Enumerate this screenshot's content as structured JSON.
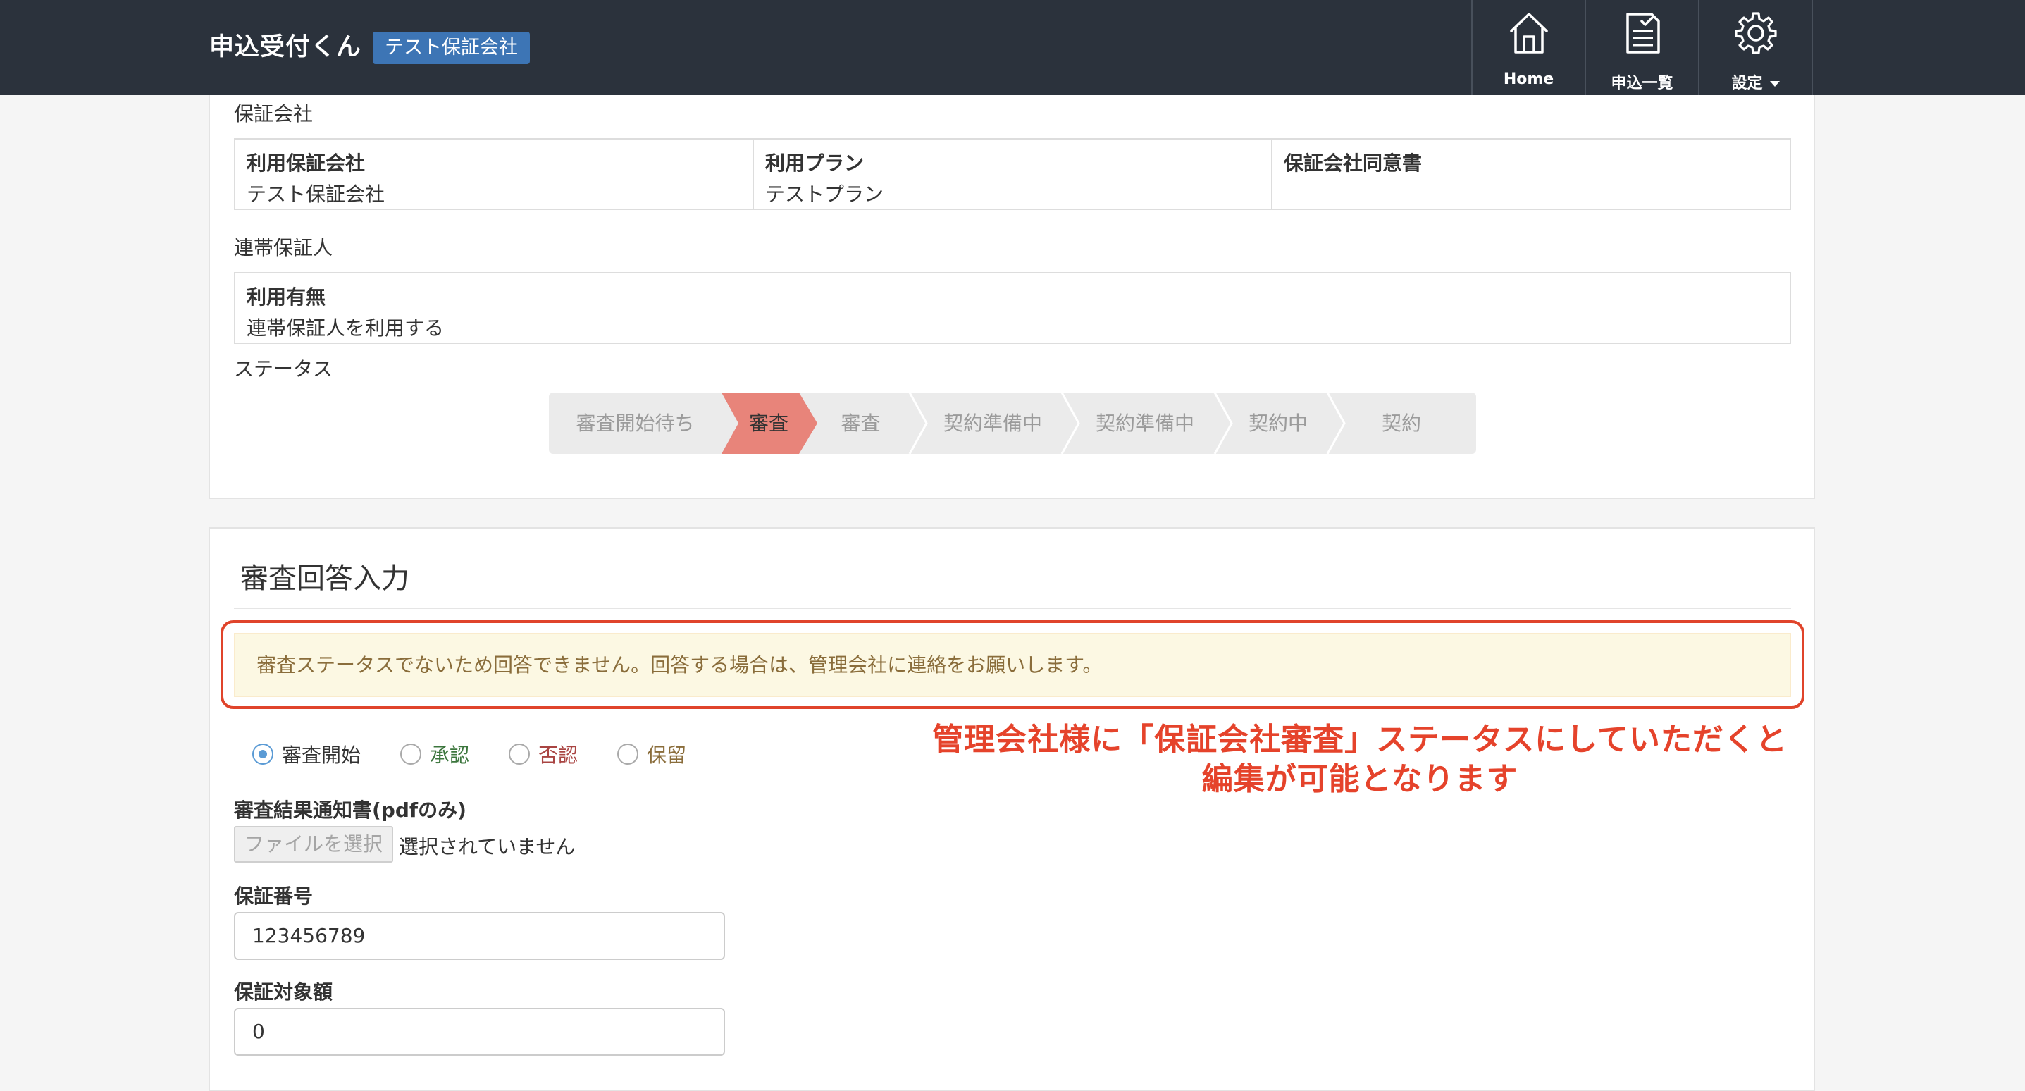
{
  "header": {
    "brand": "申込受付くん",
    "company_badge": "テスト保証会社",
    "nav": [
      {
        "label": "Home",
        "icon": "home-icon"
      },
      {
        "label": "申込一覧",
        "icon": "document-check-icon"
      },
      {
        "label": "設定",
        "icon": "gear-icon"
      }
    ]
  },
  "guarantor_section": {
    "label": "保証会社",
    "cells": [
      {
        "title": "利用保証会社",
        "value": "テスト保証会社"
      },
      {
        "title": "利用プラン",
        "value": "テストプラン"
      },
      {
        "title": "保証会社同意書",
        "value": ""
      }
    ]
  },
  "joint_guarantor_section": {
    "label": "連帯保証人",
    "title": "利用有無",
    "value": "連帯保証人を利用する"
  },
  "status_section": {
    "label": "ステータス",
    "steps": [
      "審査開始待ち",
      "審査",
      "審査",
      "契約準備中",
      "契約準備中",
      "契約中",
      "契約"
    ],
    "active_index": 1,
    "active_color": "#e8847a"
  },
  "review_form": {
    "title": "審査回答入力",
    "alert": "審査ステータスでないため回答できません。回答する場合は、管理会社に連絡をお願いします。",
    "radios": [
      {
        "label": "審査開始",
        "checked": true,
        "color": "#333333"
      },
      {
        "label": "承認",
        "checked": false,
        "color": "#3c763d"
      },
      {
        "label": "否認",
        "checked": false,
        "color": "#a94442"
      },
      {
        "label": "保留",
        "checked": false,
        "color": "#8a6d3b"
      }
    ],
    "notice_label": "審査結果通知書(pdfのみ)",
    "file_button": "ファイルを選択",
    "file_status": "選択されていません",
    "guarantee_no_label": "保証番号",
    "guarantee_no_value": "123456789",
    "amount_label": "保証対象額",
    "amount_value": "0"
  },
  "annotation": {
    "line1": "管理会社様に「保証会社審査」ステータスにしていただくと",
    "line2": "編集が可能となります",
    "color": "#e5432b"
  }
}
